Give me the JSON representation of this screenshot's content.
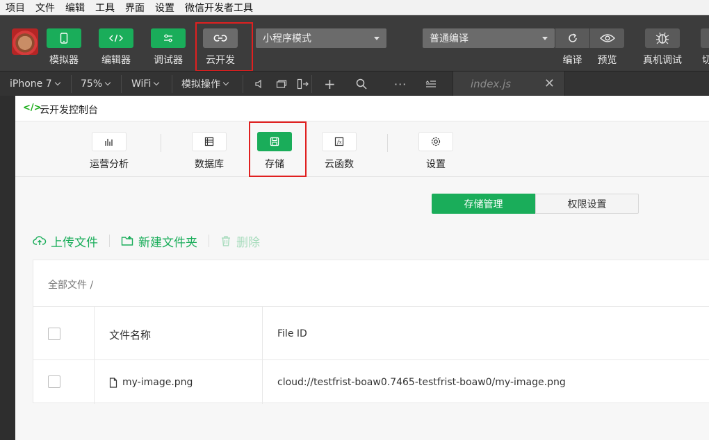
{
  "menu": [
    "项目",
    "文件",
    "编辑",
    "工具",
    "界面",
    "设置",
    "微信开发者工具"
  ],
  "toolbar": {
    "simulator_label": "模拟器",
    "editor_label": "编辑器",
    "debugger_label": "调试器",
    "cloud_label": "云开发",
    "mode_select": "小程序模式",
    "compile_select": "普通编译",
    "compile_label": "编译",
    "preview_label": "预览",
    "real_debug_label": "真机调试",
    "cut_label": "切"
  },
  "devicebar": {
    "device": "iPhone 7",
    "zoom": "75%",
    "network": "WiFi",
    "operations": "模拟操作",
    "file_tab": "index.js"
  },
  "console": {
    "logo": "</>",
    "title": "云开发控制台",
    "nav": [
      {
        "label": "运营分析"
      },
      {
        "label": "数据库"
      },
      {
        "label": "存储"
      },
      {
        "label": "云函数"
      },
      {
        "label": "设置"
      }
    ],
    "tabs": {
      "storage_mgmt": "存储管理",
      "permissions": "权限设置"
    },
    "actions": {
      "upload": "上传文件",
      "new_folder": "新建文件夹",
      "delete": "删除"
    },
    "breadcrumb": "全部文件 /",
    "table": {
      "headers": {
        "name": "文件名称",
        "file_id": "File ID"
      },
      "rows": [
        {
          "name": "my-image.png",
          "file_id": "cloud://testfrist-boaw0.7465-testfrist-boaw0/my-image.png"
        }
      ]
    }
  },
  "colors": {
    "accent": "#1aad5a",
    "highlight": "#e02020"
  }
}
